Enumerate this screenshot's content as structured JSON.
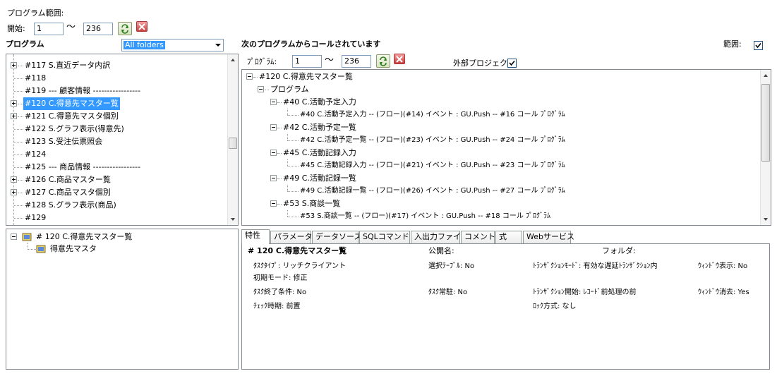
{
  "range": {
    "label": "プログラム範囲:",
    "start_label": "開始:",
    "start_value": "1",
    "tilde": "～",
    "end_value": "236"
  },
  "left_header": {
    "title": "プログラム",
    "folder_combo": "All folders"
  },
  "program_list": [
    {
      "text": "#117 S.直近データ内訳",
      "expandable": true
    },
    {
      "text": "#118",
      "expandable": false
    },
    {
      "text": "#119 --- 顧客情報 -----------------",
      "expandable": false
    },
    {
      "text": "#120 C.得意先マスター覧",
      "expandable": true,
      "selected": true
    },
    {
      "text": "#121 C.得意先マスタ個別",
      "expandable": true
    },
    {
      "text": "#122 S.グラフ表示(得意先)",
      "expandable": false
    },
    {
      "text": "#123 S.受注伝票照会",
      "expandable": false
    },
    {
      "text": "#124",
      "expandable": false
    },
    {
      "text": "#125 --- 商品情報 -----------------",
      "expandable": false
    },
    {
      "text": "#126 C.商品マスター覧",
      "expandable": true
    },
    {
      "text": "#127 C.商品マスタ個別",
      "expandable": true
    },
    {
      "text": "#128 S.グラフ表示(商品)",
      "expandable": false
    },
    {
      "text": "#129",
      "expandable": false
    }
  ],
  "caller_header": {
    "title": "次のプログラムからコールされています",
    "range_label": "範囲:",
    "prog_label": "ﾌﾟﾛｸﾞﾗﾑ:",
    "start_value": "1",
    "tilde": "～",
    "end_value": "236",
    "external_label": "外部プロジェクト"
  },
  "caller_tree": [
    {
      "text": "#120 C.得意先マスター覧",
      "level": 0,
      "collapsible": true
    },
    {
      "text": "プログラム",
      "level": 1,
      "collapsible": true
    },
    {
      "text": "#40 C.活動予定入力",
      "level": 2,
      "collapsible": true
    },
    {
      "text": "#40  C.活動予定入力 -- (フロー)(#14) イベント : GU.Push -- #16 コール ﾌﾟﾛｸﾞﾗﾑ",
      "level": 3,
      "collapsible": false
    },
    {
      "text": "#42 C.活動予定一覧",
      "level": 2,
      "collapsible": true
    },
    {
      "text": "#42  C.活動予定一覧 -- (フロー)(#23) イベント : GU.Push -- #24 コール ﾌﾟﾛｸﾞﾗﾑ",
      "level": 3,
      "collapsible": false
    },
    {
      "text": "#45 C.活動記録入力",
      "level": 2,
      "collapsible": true
    },
    {
      "text": "#45  C.活動記録入力 -- (フロー)(#21) イベント : GU.Push -- #23 コール ﾌﾟﾛｸﾞﾗﾑ",
      "level": 3,
      "collapsible": false
    },
    {
      "text": "#49 C.活動記録一覧",
      "level": 2,
      "collapsible": true
    },
    {
      "text": "#49  C.活動記録一覧 -- (フロー)(#26) イベント : GU.Push -- #27 コール ﾌﾟﾛｸﾞﾗﾑ",
      "level": 3,
      "collapsible": false
    },
    {
      "text": "#53 S.商談一覧",
      "level": 2,
      "collapsible": true
    },
    {
      "text": "#53  S.商談一覧 -- (フロー)(#17) イベント : GU.Push -- #18 コール ﾌﾟﾛｸﾞﾗﾑ",
      "level": 3,
      "collapsible": false
    }
  ],
  "task_tree": {
    "root": "# 120 C.得意先マスター覧",
    "child": "得意先マスタ"
  },
  "tabs": [
    "特性",
    "パラメータ",
    "データソース",
    "SQLコマンド",
    "入出力ファイル",
    "コメント",
    "式",
    "Webサービス"
  ],
  "properties": {
    "title": "# 120 C.得意先マスター覧",
    "public_name": "公開名:",
    "folder": "フォルダ:",
    "task_type": "ﾀｽｸﾀｲﾌﾟ: リッチクライアント",
    "select_table": "選択ﾃｰﾌﾞﾙ: No",
    "transaction_mode": "ﾄﾗﾝｻﾞｸｼｮﾝﾓｰﾄﾞ: 有効な遅延ﾄﾗﾝｻﾞｸｼｮﾝ内",
    "window_show": "ｳｨﾝﾄﾞｳ表示: No",
    "initial_mode": "初期モード: 修正",
    "task_end": "ﾀｽｸ終了条件: No",
    "task_resident": "ﾀｽｸ常駐: No",
    "transaction_start": "ﾄﾗﾝｻﾞｸｼｮﾝ開始: ﾚｺｰﾄﾞ前処理の前",
    "window_close": "ｳｨﾝﾄﾞｳ消去: Yes",
    "check_timing": "ﾁｪｯｸ時期: 前置",
    "lock_method": "ﾛｯｸ方式: なし"
  },
  "colors": {
    "selection": "#3399ff",
    "panel_border": "#828790",
    "field_border": "#7f9db9"
  }
}
